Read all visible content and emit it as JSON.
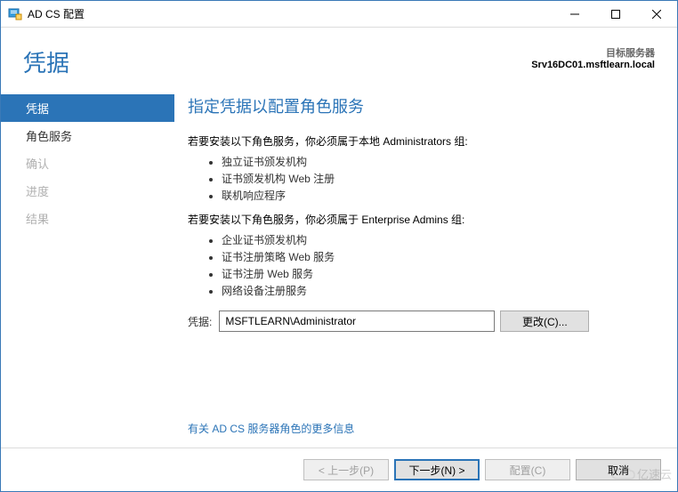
{
  "window": {
    "title": "AD CS 配置"
  },
  "header": {
    "page_title": "凭据",
    "target_label": "目标服务器",
    "target_value": "Srv16DC01.msftlearn.local"
  },
  "sidebar": {
    "items": [
      {
        "label": "凭据",
        "state": "selected"
      },
      {
        "label": "角色服务",
        "state": "normal"
      },
      {
        "label": "确认",
        "state": "disabled"
      },
      {
        "label": "进度",
        "state": "disabled"
      },
      {
        "label": "结果",
        "state": "disabled"
      }
    ]
  },
  "content": {
    "heading": "指定凭据以配置角色服务",
    "group1_intro": "若要安装以下角色服务，你必须属于本地 Administrators 组:",
    "group1_items": [
      "独立证书颁发机构",
      "证书颁发机构 Web 注册",
      "联机响应程序"
    ],
    "group2_intro": "若要安装以下角色服务，你必须属于 Enterprise Admins 组:",
    "group2_items": [
      "企业证书颁发机构",
      "证书注册策略 Web 服务",
      "证书注册 Web 服务",
      "网络设备注册服务"
    ],
    "cred_label": "凭据:",
    "cred_value": "MSFTLEARN\\Administrator",
    "change_button": "更改(C)...",
    "more_link": "有关 AD CS 服务器角色的更多信息"
  },
  "footer": {
    "prev": "< 上一步(P)",
    "next": "下一步(N) >",
    "configure": "配置(C)",
    "cancel": "取消"
  },
  "watermark": "亿速云"
}
